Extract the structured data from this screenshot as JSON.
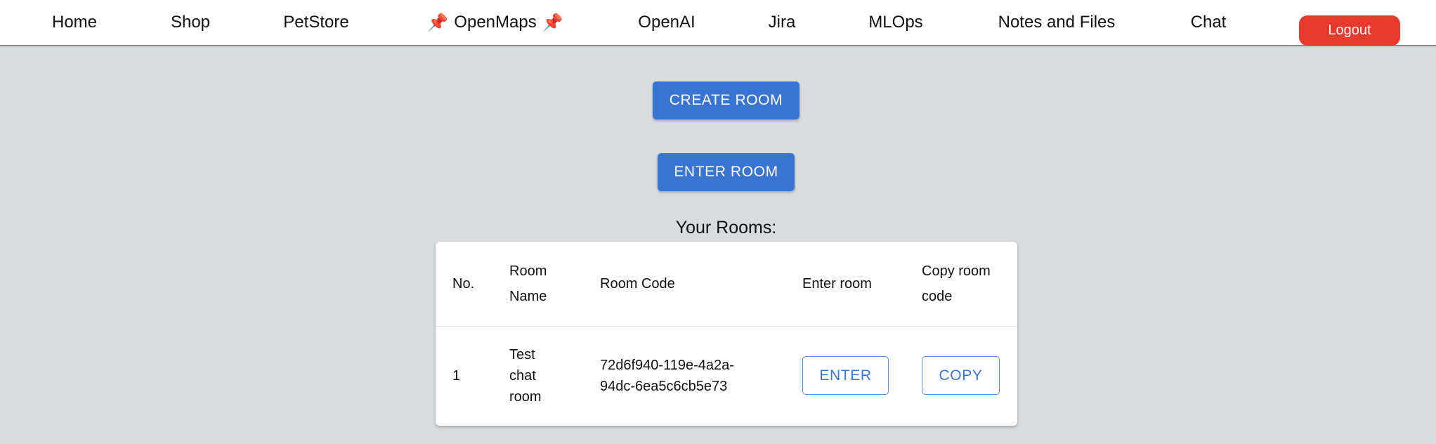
{
  "nav": {
    "items": [
      {
        "label": "Home"
      },
      {
        "label": "Shop"
      },
      {
        "label": "PetStore"
      },
      {
        "label": "OpenMaps",
        "pin_icon": "pushpin-icon"
      },
      {
        "label": "OpenAI"
      },
      {
        "label": "Jira"
      },
      {
        "label": "MLOps"
      },
      {
        "label": "Notes and Files"
      },
      {
        "label": "Chat"
      }
    ],
    "logout_label": "Logout",
    "pin_glyph": "📌"
  },
  "actions": {
    "create_room_label": "CREATE ROOM",
    "enter_room_label": "ENTER ROOM"
  },
  "rooms": {
    "title": "Your Rooms:",
    "columns": [
      "No.",
      "Room Name",
      "Room Code",
      "Enter room",
      "Copy room code"
    ],
    "rows": [
      {
        "no": "1",
        "name": "Test chat room",
        "code": "72d6f940-119e-4a2a-94dc-6ea5c6cb5e73",
        "enter_label": "ENTER",
        "copy_label": "COPY"
      }
    ]
  },
  "colors": {
    "primary": "#3a74d1",
    "logout": "#e63a2e",
    "background": "#d7dcdf"
  }
}
